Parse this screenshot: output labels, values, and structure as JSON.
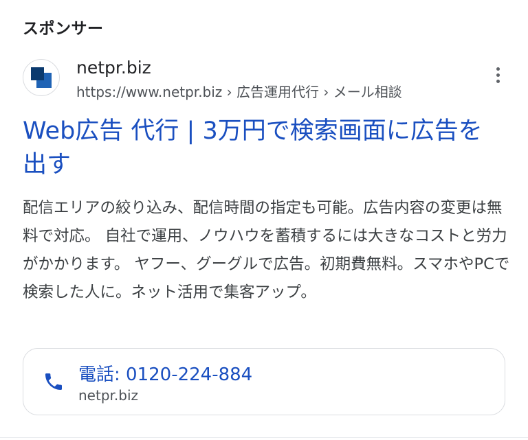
{
  "ad": {
    "sponsored_label": "スポンサー",
    "site_name": "netpr.biz",
    "display_url": "https://www.netpr.biz › 広告運用代行 › メール相談",
    "headline": "Web広告 代行 | 3万円で検索画面に広告を出す",
    "description": "配信エリアの絞り込み、配信時間の指定も可能。広告内容の変更は無料で対応。 自社で運用、ノウハウを蓄積するには大きなコストと労力がかかります。 ヤフー、グーグルで広告。初期費無料。スマホやPCで検索した人に。ネット活用で集客アップ。",
    "call": {
      "label": "電話: 0120-224-884",
      "domain": "netpr.biz"
    }
  },
  "icons": {
    "favicon": "netpr-logo-icon",
    "menu": "more-vert-icon",
    "phone": "phone-icon"
  },
  "colors": {
    "link": "#1a4fc0",
    "text": "#202124",
    "secondary": "#4d5156",
    "logo_dark": "#0b3a6e",
    "logo_mid": "#1f63b5"
  }
}
